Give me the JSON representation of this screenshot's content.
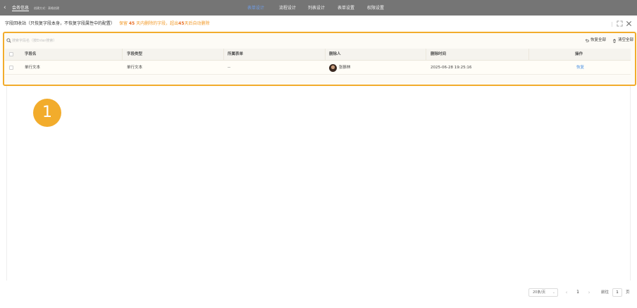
{
  "topbar": {
    "app_name": "会务信息",
    "subtitle": "创建方式：表格创建",
    "tabs": [
      {
        "label": "表单设计",
        "active": true
      },
      {
        "label": "流程设计",
        "active": false
      },
      {
        "label": "列表设计",
        "active": false
      },
      {
        "label": "表单设置",
        "active": false
      },
      {
        "label": "权限设置",
        "active": false
      }
    ]
  },
  "dialog": {
    "title": "字段回收站（只恢复字段本身，不恢复字段属性中的配置）",
    "warn_pre": "保留",
    "warn_days1": "45",
    "warn_mid": "天内删除的字段，超出",
    "warn_days2": "45",
    "warn_post": "天后自动删除",
    "search_placeholder": "搜索字段名（按Enter搜索）",
    "restore_all_label": "恢复全部",
    "clear_all_label": "清空全部"
  },
  "table": {
    "headers": [
      "字段名",
      "字段类型",
      "所属表单",
      "删除人",
      "删除时间",
      "操作"
    ],
    "rows": [
      {
        "field_name": "单行文本",
        "field_type": "单行文本",
        "form": "--",
        "deleted_by": "张振林",
        "deleted_at": "2025-06-28 19:25:16",
        "action": "恢复"
      }
    ]
  },
  "step_badge": "1",
  "pagination": {
    "page_size": "20条/页",
    "current_page": "1",
    "goto_label": "前往",
    "goto_value": "1",
    "page_unit": "页"
  },
  "colors": {
    "highlight": "#f2ac2c",
    "warning_text": "#f29b2b",
    "link": "#4a90e2",
    "active_tab": "#6f9de6"
  },
  "icons": [
    "back-arrow-icon",
    "expand-icon",
    "close-icon",
    "search-icon",
    "restore-icon",
    "trash-icon",
    "chevron-left-icon",
    "chevron-right-icon"
  ]
}
